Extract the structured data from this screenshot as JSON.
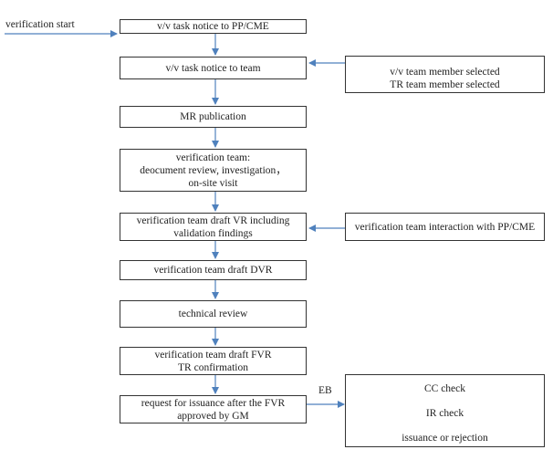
{
  "diagram": {
    "start_label": "verification start",
    "edge_label_eb": "EB",
    "arrow_color": "#4f81bd",
    "main_steps": [
      {
        "lines": [
          "v/v task notice to PP/CME"
        ]
      },
      {
        "lines": [
          "v/v task notice to team"
        ]
      },
      {
        "lines": [
          "MR publication"
        ]
      },
      {
        "lines": [
          "verification team:",
          "deocument review, investigation，",
          "on-site visit"
        ]
      },
      {
        "lines": [
          "verification team draft VR including",
          "validation findings"
        ]
      },
      {
        "lines": [
          "verification team draft DVR"
        ]
      },
      {
        "lines": [
          "technical review"
        ]
      },
      {
        "lines": [
          "verification team draft FVR",
          "TR confirmation"
        ]
      },
      {
        "lines": [
          "request for issuance after the FVR",
          "approved by GM"
        ]
      }
    ],
    "side_boxes": {
      "team_selection": {
        "lines": [
          "v/v team member selected",
          "TR team member selected"
        ]
      },
      "interaction": {
        "lines": [
          "verification team interaction with PP/CME"
        ]
      },
      "eb_checks": {
        "lines": [
          "CC check",
          "IR check",
          "issuance or rejection"
        ]
      }
    }
  }
}
